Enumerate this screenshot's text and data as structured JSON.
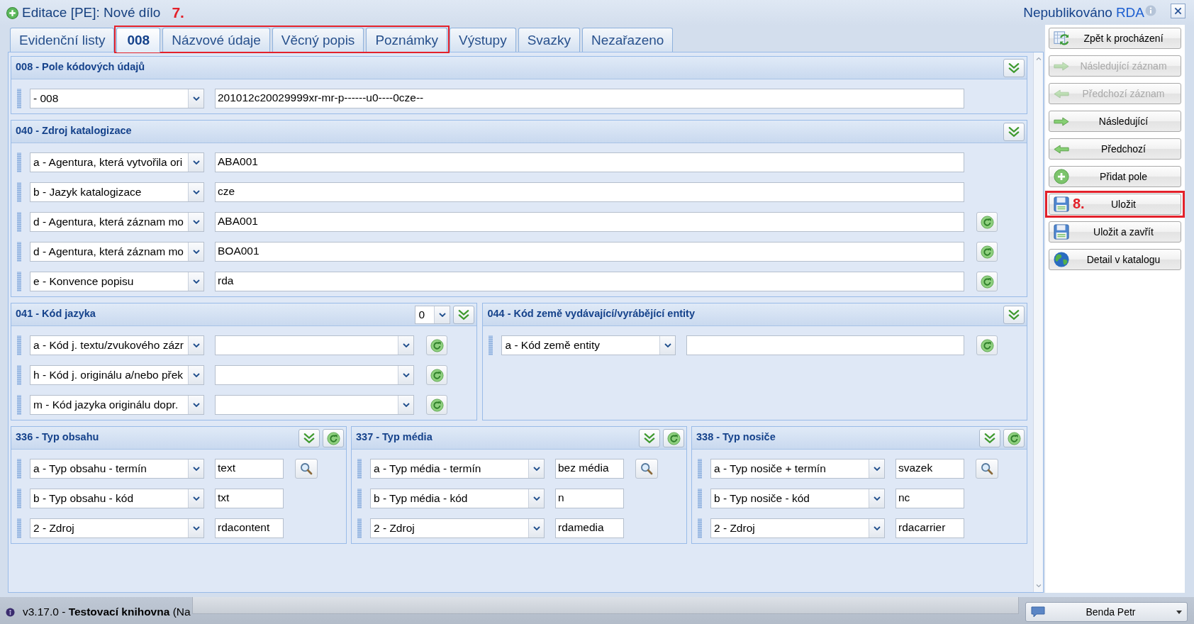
{
  "window": {
    "title": "Editace [PE]: Nové dílo",
    "callout": "7.",
    "status": "Nepublikováno",
    "status_tag": "RDA"
  },
  "tabs": [
    {
      "label": "Evidenční listy",
      "selected": false,
      "highlighted": false
    },
    {
      "label": "008",
      "selected": true,
      "highlighted": true
    },
    {
      "label": "Názvové údaje",
      "selected": false,
      "highlighted": true
    },
    {
      "label": "Věcný popis",
      "selected": false,
      "highlighted": true
    },
    {
      "label": "Poznámky",
      "selected": false,
      "highlighted": true
    },
    {
      "label": "Výstupy",
      "selected": false,
      "highlighted": false
    },
    {
      "label": "Svazky",
      "selected": false,
      "highlighted": false
    },
    {
      "label": "Nezařazeno",
      "selected": false,
      "highlighted": false
    }
  ],
  "section_rows": [
    {
      "sections": [
        {
          "title": "008 - Pole kódových údajů",
          "fields": [
            {
              "subfield": "- 008",
              "kind": "text",
              "value": "201012c20029999xr-mr-p------u0----0cze--"
            }
          ]
        }
      ]
    },
    {
      "sections": [
        {
          "title": "040 - Zdroj katalogizace",
          "fields": [
            {
              "subfield": "a - Agentura, která vytvořila ori",
              "kind": "text",
              "value": "ABA001"
            },
            {
              "subfield": "b - Jazyk katalogizace",
              "kind": "text",
              "value": "cze"
            },
            {
              "subfield": "d - Agentura, která záznam mo",
              "kind": "text",
              "value": "ABA001",
              "refresh": true
            },
            {
              "subfield": "d - Agentura, která záznam mo",
              "kind": "text",
              "value": "BOA001",
              "refresh": true
            },
            {
              "subfield": "e - Konvence popisu",
              "kind": "text",
              "value": "rda",
              "refresh": true
            }
          ]
        }
      ]
    },
    {
      "sections": [
        {
          "title": "041 - Kód jazyka",
          "count": "0",
          "fields": [
            {
              "subfield": "a - Kód j. textu/zvukového zázr",
              "kind": "select",
              "refresh": true
            },
            {
              "subfield": "h - Kód j. originálu a/nebo přek",
              "kind": "select",
              "refresh": true
            },
            {
              "subfield": "m - Kód jazyka originálu dopr.",
              "kind": "select",
              "refresh": true
            }
          ]
        },
        {
          "title": "044 - Kód země vydávající/vyrábějící entity",
          "fields": [
            {
              "subfield": "a - Kód země entity",
              "kind": "text",
              "refresh": true
            }
          ]
        }
      ]
    },
    {
      "sections": [
        {
          "title": "336 - Typ obsahu",
          "header_refresh": true,
          "fields": [
            {
              "subfield": "a - Typ obsahu - termín",
              "kind": "text",
              "value": "text",
              "search": true
            },
            {
              "subfield": "b - Typ obsahu - kód",
              "kind": "text",
              "value": "txt"
            },
            {
              "subfield": "2 - Zdroj",
              "kind": "text",
              "value": "rdacontent"
            }
          ]
        },
        {
          "title": "337 - Typ média",
          "header_refresh": true,
          "fields": [
            {
              "subfield": "a - Typ média - termín",
              "kind": "text",
              "value": "bez média",
              "search": true
            },
            {
              "subfield": "b - Typ média - kód",
              "kind": "text",
              "value": "n"
            },
            {
              "subfield": "2 - Zdroj",
              "kind": "text",
              "value": "rdamedia"
            }
          ]
        },
        {
          "title": "338 - Typ nosiče",
          "header_refresh": true,
          "fields": [
            {
              "subfield": "a - Typ nosiče + termín",
              "kind": "text",
              "value": "svazek",
              "search": true
            },
            {
              "subfield": "b - Typ nosiče - kód",
              "kind": "text",
              "value": "nc"
            },
            {
              "subfield": "2 - Zdroj",
              "kind": "text",
              "value": "rdacarrier"
            }
          ]
        }
      ]
    }
  ],
  "actions": [
    {
      "label": "Zpět k procházení",
      "kind": "back",
      "disabled": false,
      "highlighted": false
    },
    {
      "label": "Následující záznam",
      "kind": "next",
      "disabled": true,
      "highlighted": false
    },
    {
      "label": "Předchozí záznam",
      "kind": "previous",
      "disabled": true,
      "highlighted": false
    },
    {
      "label": "Následující",
      "kind": "next",
      "disabled": false,
      "highlighted": false
    },
    {
      "label": "Předchozí",
      "kind": "previous",
      "disabled": false,
      "highlighted": false
    },
    {
      "label": "Přidat pole",
      "kind": "add",
      "disabled": false,
      "highlighted": false
    },
    {
      "label": "Uložit",
      "kind": "save",
      "disabled": false,
      "highlighted": true,
      "callout": "8."
    },
    {
      "label": "Uložit a zavřít",
      "kind": "save",
      "disabled": false,
      "highlighted": false
    },
    {
      "label": "Detail v katalogu",
      "kind": "catalog",
      "disabled": false,
      "highlighted": false
    }
  ],
  "status_bar": {
    "text": "v3.17.0 - **Testovací knihovna** (Na",
    "user": "Benda Petr"
  }
}
